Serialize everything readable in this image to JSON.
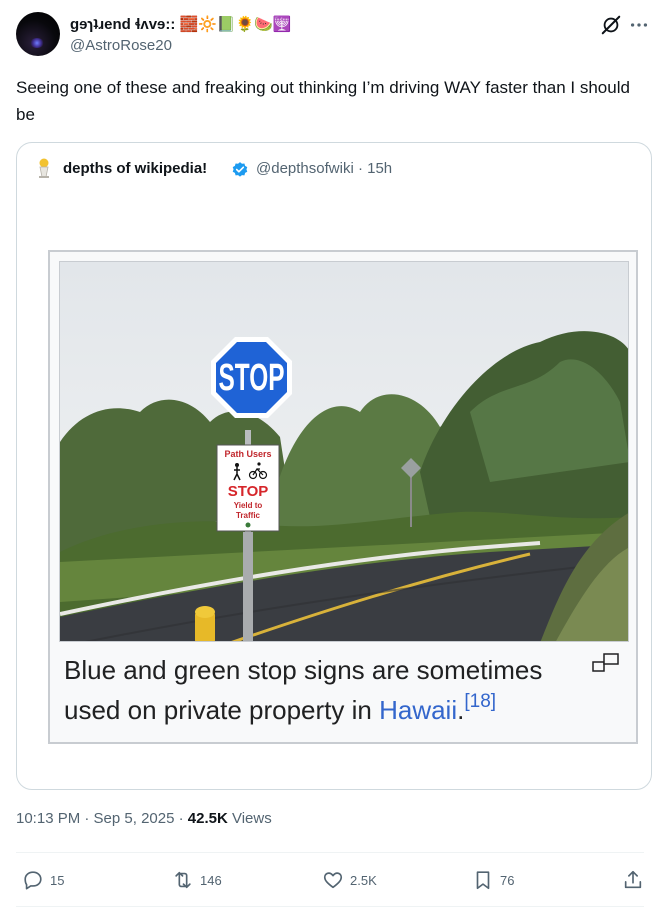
{
  "author": {
    "display_name": "gɘɿʇɹend ɬʌvɘ:: 🧱🔆📗🌻🍉🕎",
    "handle": "@AstroRose20"
  },
  "tweet": {
    "text": "Seeing one of these and freaking out thinking I’m driving WAY faster than I should be"
  },
  "quote": {
    "name": "depths of wikipedia!",
    "meta": "@depthsofwiki · 15h",
    "sign": {
      "stop": "STOP",
      "path_users": "Path Users",
      "stop_small": "STOP",
      "yield_line1": "Yield to",
      "yield_line2": "Traffic"
    },
    "caption_text": "Blue and green stop signs are sometimes used on private property in ",
    "caption_link": "Hawaii",
    "caption_end": ".",
    "caption_ref": "[18]"
  },
  "meta": {
    "time": "10:13 PM · Sep 5, 2025 · ",
    "views_count": "42.5K",
    "views_label": " Views"
  },
  "actions": {
    "replies": "15",
    "reposts": "146",
    "likes": "2.5K",
    "bookmarks": "76"
  },
  "colors": {
    "text_primary": "#0f1419",
    "text_secondary": "#536471",
    "border": "#cfd9de",
    "verified": "#1d9bf0",
    "wiki_link": "#3366cc",
    "sign_blue": "#1f63d6",
    "sign_red": "#d6262b"
  },
  "icons": [
    "grok-icon",
    "more-icon",
    "verified-icon",
    "enlarge-icon",
    "reply-icon",
    "repost-icon",
    "like-icon",
    "bookmark-icon",
    "share-icon"
  ]
}
